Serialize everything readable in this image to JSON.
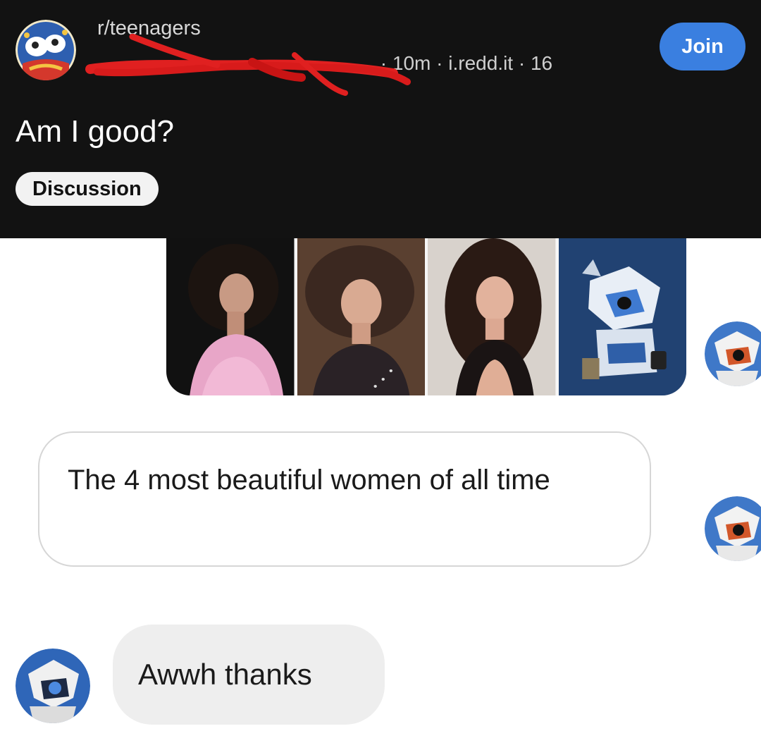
{
  "post": {
    "subreddit": "r/teenagers",
    "meta": {
      "time": "10m",
      "domain": "i.redd.it",
      "count": "16",
      "separator": "·"
    },
    "join_label": "Join",
    "title": "Am I good?",
    "flair": "Discussion"
  },
  "chat": {
    "outgoing_text": "The 4 most beautiful women of all time",
    "incoming_text": "Awwh thanks"
  },
  "colors": {
    "header_bg": "#121212",
    "join_blue": "#3a7fe0",
    "scribble_red": "#e02020"
  }
}
